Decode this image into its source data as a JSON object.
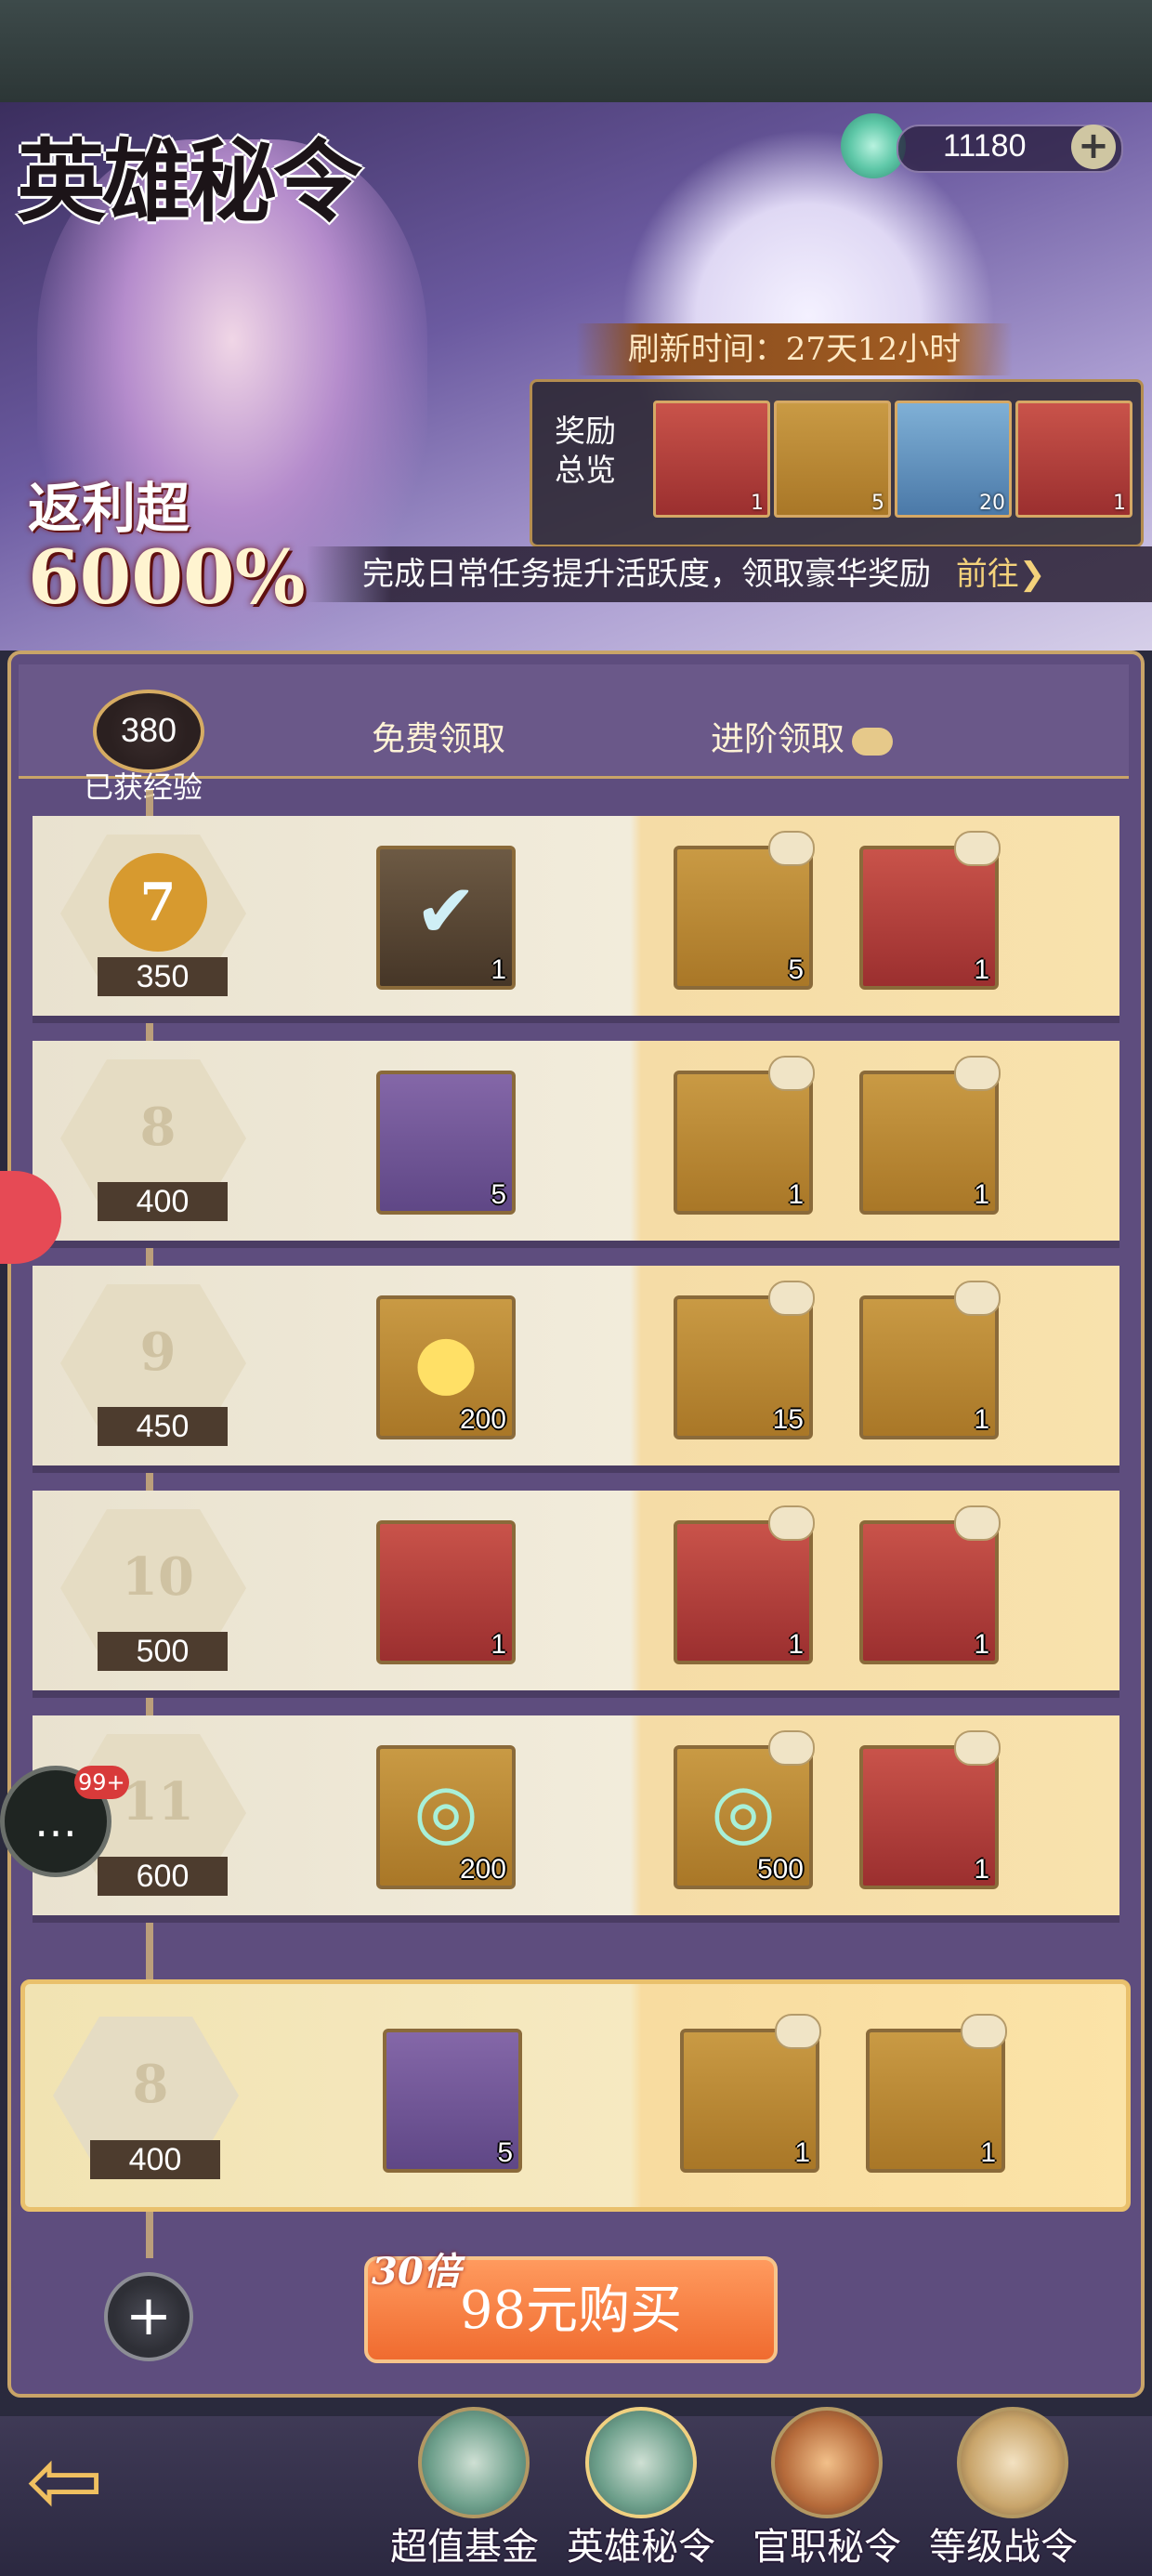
{
  "header": {
    "title": "英雄秘令",
    "currency": {
      "icon": "jade-icon",
      "value": "11180"
    },
    "refresh_text": "刷新时间：27天12小时",
    "rewards_label": "奖励总览",
    "rewards_preview": [
      {
        "icon": "token-card-icon",
        "count": "1"
      },
      {
        "icon": "flower-chest-icon",
        "count": "5"
      },
      {
        "icon": "blue-crest-icon",
        "count": "20"
      },
      {
        "icon": "red-envelope-icon",
        "count": "1"
      }
    ],
    "rebate_line1": "返利超",
    "rebate_line2": "6000%",
    "task_text": "完成日常任务提升活跃度，领取豪华奖励",
    "task_link": "前往",
    "task_link_icon": "chevron-right-icon"
  },
  "panel": {
    "exp_value": "380",
    "exp_label": "已获经验",
    "col_free": "免费领取",
    "col_advanced": "进阶领取",
    "rows": [
      {
        "level": "7",
        "exp": "350",
        "active": true,
        "free": {
          "icon": "claimed-card-icon",
          "count": "1"
        },
        "adv": [
          {
            "icon": "gold-token-icon",
            "count": "5"
          },
          {
            "icon": "treasure-chest-icon",
            "count": "1"
          }
        ]
      },
      {
        "level": "8",
        "exp": "400",
        "free": {
          "icon": "kunai-icon",
          "count": "5"
        },
        "adv": [
          {
            "icon": "kunai-icon",
            "count": "1"
          },
          {
            "icon": "flower-chest-icon",
            "count": "1"
          }
        ]
      },
      {
        "level": "9",
        "exp": "450",
        "free": {
          "icon": "gold-orb-icon",
          "count": "200"
        },
        "adv": [
          {
            "icon": "helmet-icon",
            "count": "15"
          },
          {
            "icon": "kunai-icon",
            "count": "1"
          }
        ]
      },
      {
        "level": "10",
        "exp": "500",
        "free": {
          "icon": "red-envelope-icon",
          "count": "1"
        },
        "adv": [
          {
            "icon": "red-envelope-icon",
            "count": "1"
          },
          {
            "icon": "treasure-chest-icon",
            "count": "1"
          }
        ]
      },
      {
        "level": "11",
        "exp": "600",
        "free": {
          "icon": "jade-icon",
          "count": "200"
        },
        "adv": [
          {
            "icon": "jade-icon",
            "count": "500"
          },
          {
            "icon": "red-envelope-icon",
            "count": "1"
          }
        ]
      }
    ],
    "featured": {
      "level": "8",
      "exp": "400",
      "free": {
        "icon": "kunai-icon",
        "count": "5"
      },
      "adv": [
        {
          "icon": "kunai-icon",
          "count": "1"
        },
        {
          "icon": "flower-chest-icon",
          "count": "1"
        }
      ]
    },
    "multiplier": "30倍",
    "buy_label": "98元购买"
  },
  "chat_badge": "99+",
  "nav": [
    {
      "label": "超值基金",
      "icon": "fund-icon"
    },
    {
      "label": "英雄秘令",
      "icon": "hero-pass-icon"
    },
    {
      "label": "官职秘令",
      "icon": "official-pass-icon"
    },
    {
      "label": "等级战令",
      "icon": "level-pass-icon"
    }
  ]
}
